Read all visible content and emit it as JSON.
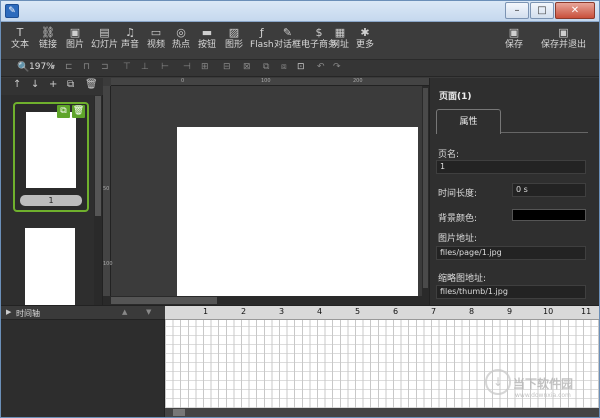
{
  "window": {
    "close": "✕",
    "minimize": "–",
    "maximize": "□"
  },
  "toolbar": {
    "items": [
      {
        "label": "文本",
        "icon": "text-icon",
        "glyph": "T"
      },
      {
        "label": "链接",
        "icon": "link-icon",
        "glyph": "⛓"
      },
      {
        "label": "图片",
        "icon": "image-icon",
        "glyph": "▣"
      },
      {
        "label": "幻灯片",
        "icon": "slideshow-icon",
        "glyph": "▤"
      },
      {
        "label": "声音",
        "icon": "sound-icon",
        "glyph": "♫"
      },
      {
        "label": "视频",
        "icon": "video-icon",
        "glyph": "▭"
      },
      {
        "label": "热点",
        "icon": "hotspot-icon",
        "glyph": "◎"
      },
      {
        "label": "按钮",
        "icon": "button-icon",
        "glyph": "▬"
      },
      {
        "label": "图形",
        "icon": "shape-icon",
        "glyph": "▨"
      },
      {
        "label": "Flash",
        "icon": "flash-icon",
        "glyph": "ƒ"
      },
      {
        "label": "对话框",
        "icon": "dialog-icon",
        "glyph": "✎"
      },
      {
        "label": "电子商务",
        "icon": "ecommerce-icon",
        "glyph": "$"
      },
      {
        "label": "网址",
        "icon": "url-icon",
        "glyph": "▦"
      },
      {
        "label": "更多",
        "icon": "more-icon",
        "glyph": "✱"
      }
    ],
    "save": {
      "label": "保存",
      "glyph": "▣"
    },
    "save_exit": {
      "label": "保存并退出",
      "glyph": "▣"
    }
  },
  "zoom": {
    "value": "197%",
    "dropdown": "▾"
  },
  "pages_panel": {
    "tools": [
      "↑",
      "↓",
      "+",
      "⧉",
      "🗑"
    ],
    "page_number": "1",
    "copy_glyph": "⧉",
    "delete_glyph": "🗑"
  },
  "ruler": {
    "top_labels": [
      "0",
      "100",
      "200"
    ],
    "left_labels": [
      "50",
      "100"
    ]
  },
  "properties": {
    "title": "页面(1)",
    "tab": "属性",
    "page_name_label": "页名:",
    "page_name_value": "1",
    "duration_label": "时间长度:",
    "duration_value": "0 s",
    "bg_color_label": "背景颜色:",
    "bg_color": "#000000",
    "image_url_label": "图片地址:",
    "image_url_value": "files/page/1.jpg",
    "thumb_url_label": "缩略图地址:",
    "thumb_url_value": "files/thumb/1.jpg"
  },
  "timeline": {
    "title": "时间轴",
    "ticks": [
      "1",
      "2",
      "3",
      "4",
      "5",
      "6",
      "7",
      "8",
      "9",
      "10",
      "11"
    ]
  },
  "watermark": {
    "text": "当下软件园",
    "sub": "www.downxia.com",
    "glyph": "↓"
  }
}
